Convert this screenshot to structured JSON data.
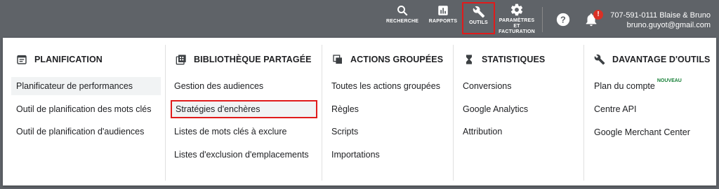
{
  "toolbar": {
    "search_label": "RECHERCHE",
    "reports_label": "RAPPORTS",
    "tools_label": "OUTILS",
    "settings_label_1": "PARAMÈTRES",
    "settings_label_2": "ET",
    "settings_label_3": "FACTURATION",
    "notif_count": "!",
    "account_line1": "707-591-0111 Blaise & Bruno",
    "account_line2": "bruno.guyot@gmail.com"
  },
  "menu": {
    "planning": {
      "title": "PLANIFICATION",
      "items": [
        "Planificateur de performances",
        "Outil de planification des mots clés",
        "Outil de planification d'audiences"
      ]
    },
    "shared_library": {
      "title": "BIBLIOTHÈQUE PARTAGÉE",
      "items": [
        "Gestion des audiences",
        "Stratégies d'enchères",
        "Listes de mots clés à exclure",
        "Listes d'exclusion d'emplacements"
      ]
    },
    "bulk_actions": {
      "title": "ACTIONS GROUPÉES",
      "items": [
        "Toutes les actions groupées",
        "Règles",
        "Scripts",
        "Importations"
      ]
    },
    "measurement": {
      "title": "STATISTIQUES",
      "items": [
        "Conversions",
        "Google Analytics",
        "Attribution"
      ]
    },
    "more_tools": {
      "title": "DAVANTAGE D'OUTILS",
      "items": [
        "Plan du compte",
        "Centre API",
        "Google Merchant Center"
      ],
      "new_badge": "NOUVEAU"
    }
  },
  "colors": {
    "topbar": "#5f6368",
    "highlight_box": "#e01b1b",
    "new_badge": "#188038"
  }
}
